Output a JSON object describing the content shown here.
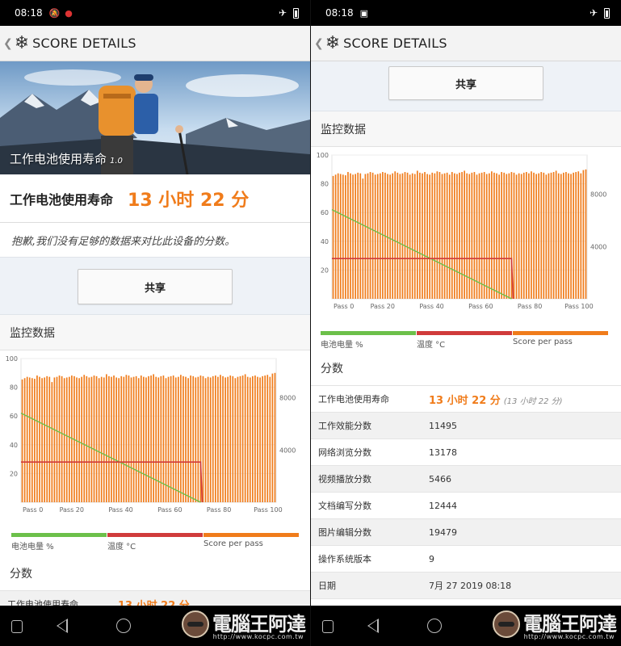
{
  "status_left": {
    "time": "08:18"
  },
  "status_right": {
    "time": "08:18"
  },
  "appbar": {
    "title": "SCORE DETAILS"
  },
  "hero": {
    "title": "工作电池使用寿命",
    "version": "1.0"
  },
  "life": {
    "label": "工作电池使用寿命",
    "value": "13 小时 22 分"
  },
  "note": "抱歉,我们没有足够的数据来对比此设备的分数。",
  "share_label": "共享",
  "monitor_title": "监控数据",
  "scores_title": "分数",
  "legend": [
    {
      "label": "电池电量 %",
      "color": "#6cc04a"
    },
    {
      "label": "温度 °C",
      "color": "#d03b3b"
    },
    {
      "label": "Score per pass",
      "color": "#f07c1b"
    }
  ],
  "chart_data": {
    "type": "bar",
    "x_tick_labels": [
      "Pass 0",
      "Pass 20",
      "Pass 40",
      "Pass 60",
      "Pass 80",
      "Pass 100"
    ],
    "y_left_ticks": [
      "20",
      "40",
      "60",
      "80",
      "100"
    ],
    "y_right_ticks": [
      "4000",
      "8000"
    ],
    "ylim_left": [
      0,
      100
    ],
    "ylim_right": [
      0,
      11000
    ],
    "passes": 103,
    "score_series_name": "Score per pass",
    "score_values": [
      9400,
      9500,
      9600,
      9550,
      9500,
      9450,
      9700,
      9600,
      9500,
      9550,
      9650,
      9600,
      9200,
      9550,
      9600,
      9700,
      9650,
      9500,
      9550,
      9600,
      9700,
      9650,
      9550,
      9500,
      9600,
      9750,
      9650,
      9550,
      9600,
      9700,
      9650,
      9500,
      9600,
      9550,
      9800,
      9650,
      9600,
      9700,
      9550,
      9500,
      9650,
      9600,
      9750,
      9700,
      9550,
      9600,
      9650,
      9500,
      9700,
      9600,
      9550,
      9650,
      9700,
      9800,
      9600,
      9550,
      9650,
      9700,
      9500,
      9600,
      9650,
      9700,
      9550,
      9600,
      9750,
      9650,
      9600,
      9500,
      9700,
      9650,
      9550,
      9600,
      9700,
      9650,
      9500,
      9600,
      9550,
      9650,
      9700,
      9600,
      9750,
      9650,
      9550,
      9600,
      9700,
      9650,
      9500,
      9600,
      9650,
      9700,
      9800,
      9600,
      9550,
      9650,
      9700,
      9600,
      9550,
      9650,
      9700,
      9750,
      9600,
      9850,
      9900
    ],
    "battery_series_name": "电池电量 %",
    "battery_start": 62,
    "battery_end": 0,
    "battery_end_pass": 72,
    "temp_series_name": "温度 °C",
    "temp_level": 28,
    "temp_drop_pass": 72
  },
  "scores": [
    {
      "key": "工作电池使用寿命",
      "value": "13 小时 22 分",
      "sub": "(13 小时 22 分)",
      "highlight": true
    },
    {
      "key": "工作效能分数",
      "value": "11495"
    },
    {
      "key": "网络浏览分数",
      "value": "13178"
    },
    {
      "key": "视频播放分数",
      "value": "5466"
    },
    {
      "key": "文档编写分数",
      "value": "12444"
    },
    {
      "key": "图片编辑分数",
      "value": "19479"
    },
    {
      "key": "操作系统版本",
      "value": "9"
    },
    {
      "key": "日期",
      "value": "7月 27 2019 08:18"
    }
  ],
  "watermark": {
    "logo": "電腦王阿達",
    "url": "http://www.kocpc.com.tw"
  }
}
